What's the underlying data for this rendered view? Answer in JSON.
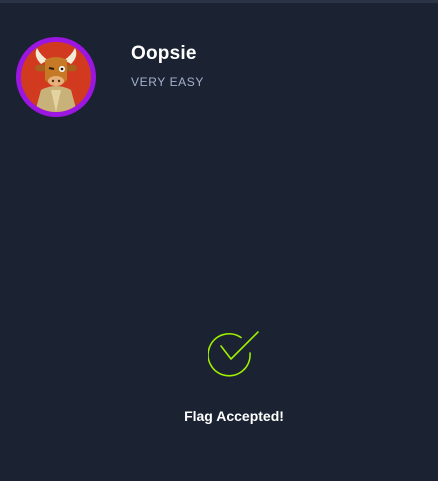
{
  "machine": {
    "name": "Oopsie",
    "difficulty": "VERY EASY",
    "avatar": "bull-mascot-avatar"
  },
  "result": {
    "icon": "check-circle-icon",
    "message": "Flag Accepted!"
  },
  "colors": {
    "background": "#1b2333",
    "avatar_ring": "#9b16e0",
    "avatar_bg": "#d13a1f",
    "check": "#9fef00",
    "difficulty_text": "#a4b1cd"
  }
}
